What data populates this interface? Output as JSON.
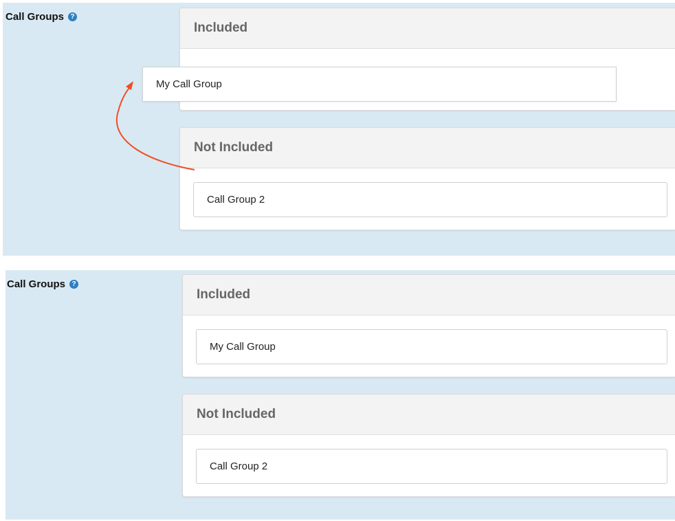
{
  "before": {
    "field_label": "Call Groups",
    "included_header": "Included",
    "dragged_item": "My Call Group",
    "not_included_header": "Not Included",
    "not_included_items": [
      "Call Group 2"
    ]
  },
  "after": {
    "field_label": "Call Groups",
    "included_header": "Included",
    "included_items": [
      "My Call Group"
    ],
    "not_included_header": "Not Included",
    "not_included_items": [
      "Call Group 2"
    ]
  },
  "icons": {
    "help": "question-circle-icon",
    "drag_arrow": "curved-arrow-icon"
  },
  "colors": {
    "panel_bg": "#d9e9f3",
    "help_icon": "#2f7fc1",
    "arrow": "#f04e23",
    "header_bg": "#f3f3f3",
    "header_text": "#666666"
  }
}
